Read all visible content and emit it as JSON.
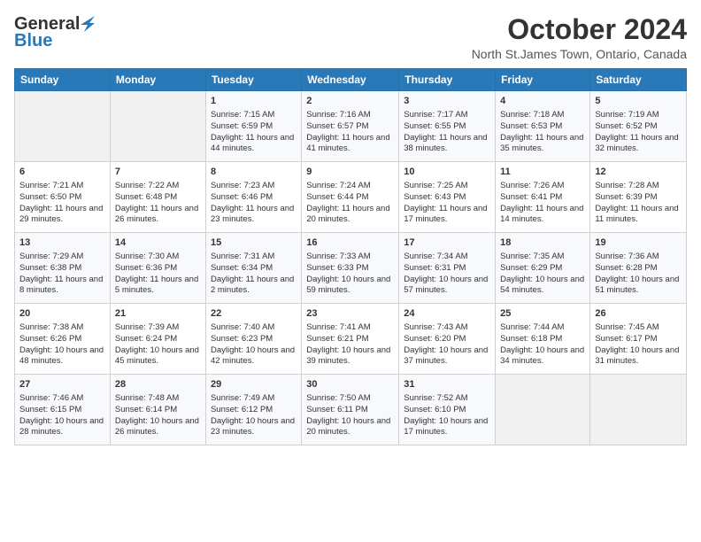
{
  "header": {
    "logo_general": "General",
    "logo_blue": "Blue",
    "title": "October 2024",
    "location": "North St.James Town, Ontario, Canada"
  },
  "weekdays": [
    "Sunday",
    "Monday",
    "Tuesday",
    "Wednesday",
    "Thursday",
    "Friday",
    "Saturday"
  ],
  "weeks": [
    [
      {
        "day": "",
        "sunrise": "",
        "sunset": "",
        "daylight": ""
      },
      {
        "day": "",
        "sunrise": "",
        "sunset": "",
        "daylight": ""
      },
      {
        "day": "1",
        "sunrise": "Sunrise: 7:15 AM",
        "sunset": "Sunset: 6:59 PM",
        "daylight": "Daylight: 11 hours and 44 minutes."
      },
      {
        "day": "2",
        "sunrise": "Sunrise: 7:16 AM",
        "sunset": "Sunset: 6:57 PM",
        "daylight": "Daylight: 11 hours and 41 minutes."
      },
      {
        "day": "3",
        "sunrise": "Sunrise: 7:17 AM",
        "sunset": "Sunset: 6:55 PM",
        "daylight": "Daylight: 11 hours and 38 minutes."
      },
      {
        "day": "4",
        "sunrise": "Sunrise: 7:18 AM",
        "sunset": "Sunset: 6:53 PM",
        "daylight": "Daylight: 11 hours and 35 minutes."
      },
      {
        "day": "5",
        "sunrise": "Sunrise: 7:19 AM",
        "sunset": "Sunset: 6:52 PM",
        "daylight": "Daylight: 11 hours and 32 minutes."
      }
    ],
    [
      {
        "day": "6",
        "sunrise": "Sunrise: 7:21 AM",
        "sunset": "Sunset: 6:50 PM",
        "daylight": "Daylight: 11 hours and 29 minutes."
      },
      {
        "day": "7",
        "sunrise": "Sunrise: 7:22 AM",
        "sunset": "Sunset: 6:48 PM",
        "daylight": "Daylight: 11 hours and 26 minutes."
      },
      {
        "day": "8",
        "sunrise": "Sunrise: 7:23 AM",
        "sunset": "Sunset: 6:46 PM",
        "daylight": "Daylight: 11 hours and 23 minutes."
      },
      {
        "day": "9",
        "sunrise": "Sunrise: 7:24 AM",
        "sunset": "Sunset: 6:44 PM",
        "daylight": "Daylight: 11 hours and 20 minutes."
      },
      {
        "day": "10",
        "sunrise": "Sunrise: 7:25 AM",
        "sunset": "Sunset: 6:43 PM",
        "daylight": "Daylight: 11 hours and 17 minutes."
      },
      {
        "day": "11",
        "sunrise": "Sunrise: 7:26 AM",
        "sunset": "Sunset: 6:41 PM",
        "daylight": "Daylight: 11 hours and 14 minutes."
      },
      {
        "day": "12",
        "sunrise": "Sunrise: 7:28 AM",
        "sunset": "Sunset: 6:39 PM",
        "daylight": "Daylight: 11 hours and 11 minutes."
      }
    ],
    [
      {
        "day": "13",
        "sunrise": "Sunrise: 7:29 AM",
        "sunset": "Sunset: 6:38 PM",
        "daylight": "Daylight: 11 hours and 8 minutes."
      },
      {
        "day": "14",
        "sunrise": "Sunrise: 7:30 AM",
        "sunset": "Sunset: 6:36 PM",
        "daylight": "Daylight: 11 hours and 5 minutes."
      },
      {
        "day": "15",
        "sunrise": "Sunrise: 7:31 AM",
        "sunset": "Sunset: 6:34 PM",
        "daylight": "Daylight: 11 hours and 2 minutes."
      },
      {
        "day": "16",
        "sunrise": "Sunrise: 7:33 AM",
        "sunset": "Sunset: 6:33 PM",
        "daylight": "Daylight: 10 hours and 59 minutes."
      },
      {
        "day": "17",
        "sunrise": "Sunrise: 7:34 AM",
        "sunset": "Sunset: 6:31 PM",
        "daylight": "Daylight: 10 hours and 57 minutes."
      },
      {
        "day": "18",
        "sunrise": "Sunrise: 7:35 AM",
        "sunset": "Sunset: 6:29 PM",
        "daylight": "Daylight: 10 hours and 54 minutes."
      },
      {
        "day": "19",
        "sunrise": "Sunrise: 7:36 AM",
        "sunset": "Sunset: 6:28 PM",
        "daylight": "Daylight: 10 hours and 51 minutes."
      }
    ],
    [
      {
        "day": "20",
        "sunrise": "Sunrise: 7:38 AM",
        "sunset": "Sunset: 6:26 PM",
        "daylight": "Daylight: 10 hours and 48 minutes."
      },
      {
        "day": "21",
        "sunrise": "Sunrise: 7:39 AM",
        "sunset": "Sunset: 6:24 PM",
        "daylight": "Daylight: 10 hours and 45 minutes."
      },
      {
        "day": "22",
        "sunrise": "Sunrise: 7:40 AM",
        "sunset": "Sunset: 6:23 PM",
        "daylight": "Daylight: 10 hours and 42 minutes."
      },
      {
        "day": "23",
        "sunrise": "Sunrise: 7:41 AM",
        "sunset": "Sunset: 6:21 PM",
        "daylight": "Daylight: 10 hours and 39 minutes."
      },
      {
        "day": "24",
        "sunrise": "Sunrise: 7:43 AM",
        "sunset": "Sunset: 6:20 PM",
        "daylight": "Daylight: 10 hours and 37 minutes."
      },
      {
        "day": "25",
        "sunrise": "Sunrise: 7:44 AM",
        "sunset": "Sunset: 6:18 PM",
        "daylight": "Daylight: 10 hours and 34 minutes."
      },
      {
        "day": "26",
        "sunrise": "Sunrise: 7:45 AM",
        "sunset": "Sunset: 6:17 PM",
        "daylight": "Daylight: 10 hours and 31 minutes."
      }
    ],
    [
      {
        "day": "27",
        "sunrise": "Sunrise: 7:46 AM",
        "sunset": "Sunset: 6:15 PM",
        "daylight": "Daylight: 10 hours and 28 minutes."
      },
      {
        "day": "28",
        "sunrise": "Sunrise: 7:48 AM",
        "sunset": "Sunset: 6:14 PM",
        "daylight": "Daylight: 10 hours and 26 minutes."
      },
      {
        "day": "29",
        "sunrise": "Sunrise: 7:49 AM",
        "sunset": "Sunset: 6:12 PM",
        "daylight": "Daylight: 10 hours and 23 minutes."
      },
      {
        "day": "30",
        "sunrise": "Sunrise: 7:50 AM",
        "sunset": "Sunset: 6:11 PM",
        "daylight": "Daylight: 10 hours and 20 minutes."
      },
      {
        "day": "31",
        "sunrise": "Sunrise: 7:52 AM",
        "sunset": "Sunset: 6:10 PM",
        "daylight": "Daylight: 10 hours and 17 minutes."
      },
      {
        "day": "",
        "sunrise": "",
        "sunset": "",
        "daylight": ""
      },
      {
        "day": "",
        "sunrise": "",
        "sunset": "",
        "daylight": ""
      }
    ]
  ]
}
